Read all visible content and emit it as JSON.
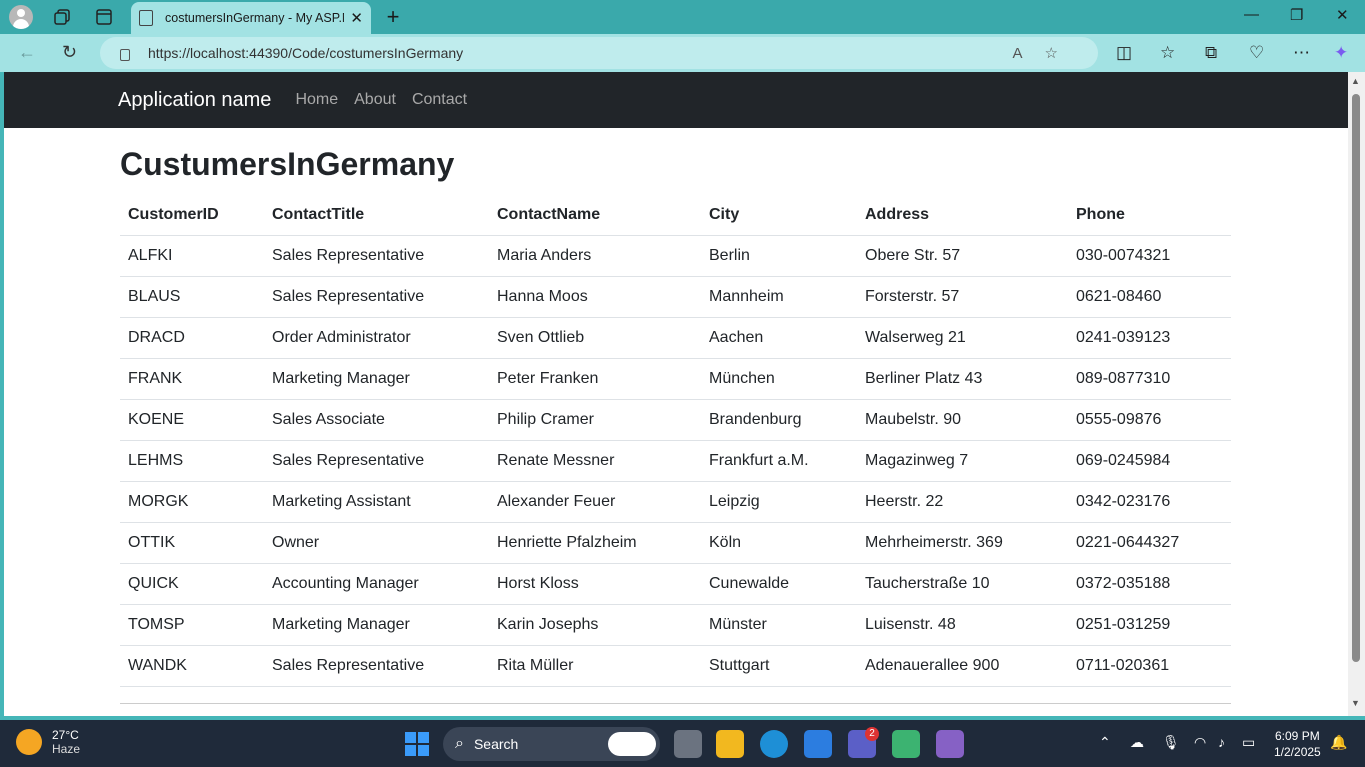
{
  "browser": {
    "tab_title": "costumersInGermany - My ASP.N",
    "url": "https://localhost:44390/Code/costumersInGermany"
  },
  "site": {
    "brand": "Application name",
    "nav": [
      "Home",
      "About",
      "Contact"
    ]
  },
  "page": {
    "title": "CustumersInGermany",
    "columns": [
      "CustomerID",
      "ContactTitle",
      "ContactName",
      "City",
      "Address",
      "Phone"
    ],
    "rows": [
      [
        "ALFKI",
        "Sales Representative",
        "Maria Anders",
        "Berlin",
        "Obere Str. 57",
        "030-0074321"
      ],
      [
        "BLAUS",
        "Sales Representative",
        "Hanna Moos",
        "Mannheim",
        "Forsterstr. 57",
        "0621-08460"
      ],
      [
        "DRACD",
        "Order Administrator",
        "Sven Ottlieb",
        "Aachen",
        "Walserweg 21",
        "0241-039123"
      ],
      [
        "FRANK",
        "Marketing Manager",
        "Peter Franken",
        "München",
        "Berliner Platz 43",
        "089-0877310"
      ],
      [
        "KOENE",
        "Sales Associate",
        "Philip Cramer",
        "Brandenburg",
        "Maubelstr. 90",
        "0555-09876"
      ],
      [
        "LEHMS",
        "Sales Representative",
        "Renate Messner",
        "Frankfurt a.M.",
        "Magazinweg 7",
        "069-0245984"
      ],
      [
        "MORGK",
        "Marketing Assistant",
        "Alexander Feuer",
        "Leipzig",
        "Heerstr. 22",
        "0342-023176"
      ],
      [
        "OTTIK",
        "Owner",
        "Henriette Pfalzheim",
        "Köln",
        "Mehrheimerstr. 369",
        "0221-0644327"
      ],
      [
        "QUICK",
        "Accounting Manager",
        "Horst Kloss",
        "Cunewalde",
        "Taucherstraße 10",
        "0372-035188"
      ],
      [
        "TOMSP",
        "Marketing Manager",
        "Karin Josephs",
        "Münster",
        "Luisenstr. 48",
        "0251-031259"
      ],
      [
        "WANDK",
        "Sales Representative",
        "Rita Müller",
        "Stuttgart",
        "Adenauerallee 900",
        "0711-020361"
      ]
    ]
  },
  "taskbar": {
    "temp": "27°C",
    "condition": "Haze",
    "search_label": "Search",
    "teams_badge": "2",
    "time": "6:09 PM",
    "date": "1/2/2025"
  },
  "colors": {
    "site_navbar": "#212529",
    "browser_frame": "#3aa9ab",
    "taskbar": "#1f2a3a"
  }
}
